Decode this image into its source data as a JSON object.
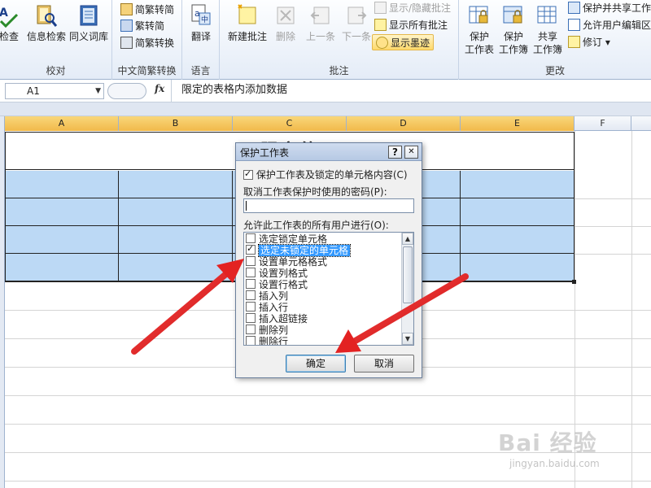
{
  "ribbon": {
    "groups": {
      "proofing": {
        "label": "校对",
        "buttons": [
          "检查",
          "信息检索",
          "同义词库"
        ]
      },
      "chinese_conversion": {
        "label": "中文简繁转换",
        "buttons": [
          "简繁转简",
          "繁转简",
          "简繁转换"
        ]
      },
      "language": {
        "label": "语言",
        "buttons": [
          "翻译"
        ]
      },
      "comments": {
        "label": "批注",
        "new_comment": "新建批注",
        "delete": "删除",
        "previous": "上一条",
        "next": "下一条",
        "show_hide": "显示/隐藏批注",
        "show_all": "显示所有批注",
        "show_ink": "显示墨迹"
      },
      "changes": {
        "label": "更改",
        "protect_sheet": [
          "保护",
          "工作表"
        ],
        "protect_workbook": [
          "保护",
          "工作簿"
        ],
        "share_workbook": [
          "共享",
          "工作簿"
        ],
        "protect_and_share": "保护并共享工作簿",
        "allow_edit_ranges": "允许用户编辑区",
        "track_changes": "修订 ▾"
      }
    }
  },
  "formula_bar": {
    "name_box": "A1",
    "name_box_arrow": "▼",
    "zoom_placeholder": "",
    "fx": "fx",
    "formula": "限定的表格内添加数据"
  },
  "sheet": {
    "columns": [
      "A",
      "B",
      "C",
      "D",
      "E",
      "F"
    ],
    "title_cell": "限定的"
  },
  "dialog": {
    "title": "保护工作表",
    "help_btn": "?",
    "close_btn": "✕",
    "protect_checkbox_label": "保护工作表及锁定的单元格内容(C)",
    "password_label": "取消工作表保护时使用的密码(P):",
    "allow_label": "允许此工作表的所有用户进行(O):",
    "permissions": [
      {
        "label": "选定锁定单元格",
        "checked": false
      },
      {
        "label": "选定未锁定的单元格",
        "checked": true
      },
      {
        "label": "设置单元格格式",
        "checked": false
      },
      {
        "label": "设置列格式",
        "checked": false
      },
      {
        "label": "设置行格式",
        "checked": false
      },
      {
        "label": "插入列",
        "checked": false
      },
      {
        "label": "插入行",
        "checked": false
      },
      {
        "label": "插入超链接",
        "checked": false
      },
      {
        "label": "删除列",
        "checked": false
      },
      {
        "label": "删除行",
        "checked": false
      }
    ],
    "ok_label": "确定",
    "cancel_label": "取消"
  },
  "watermark": {
    "logo": "Bai 经验",
    "url": "jingyan.baidu.com"
  },
  "colors": {
    "selection_blue": "#bcd9f5",
    "column_highlight": "#f1b94a",
    "arrow_red": "#e32222",
    "list_highlight": "#3399ff"
  }
}
